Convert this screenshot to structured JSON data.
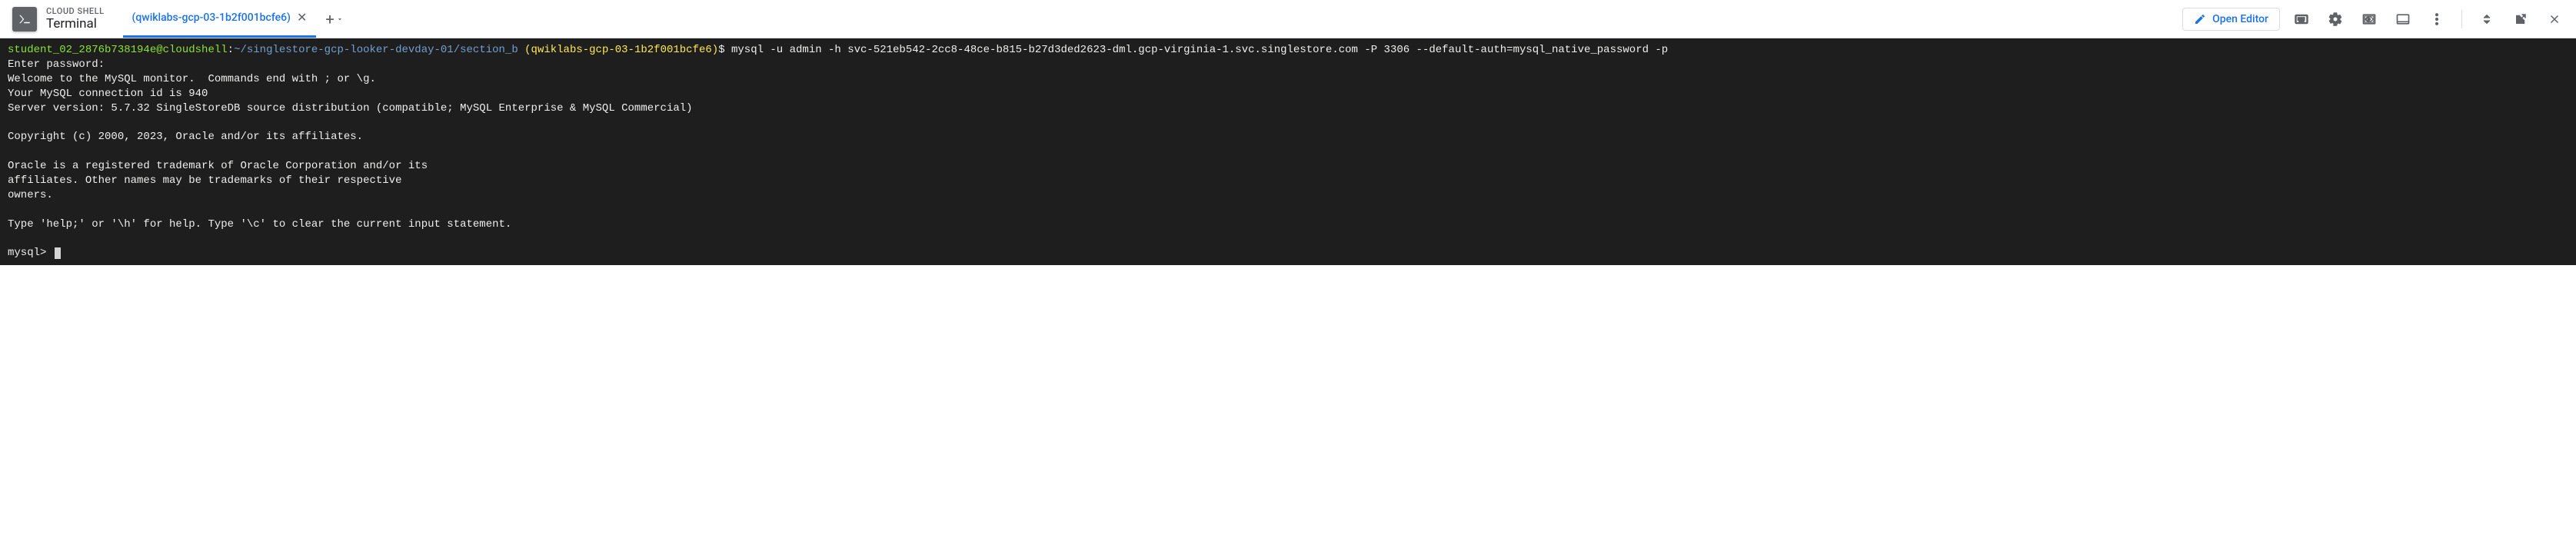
{
  "header": {
    "title_small": "CLOUD SHELL",
    "title_large": "Terminal",
    "tab_label": "(qwiklabs-gcp-03-1b2f001bcfe6)",
    "open_editor_label": "Open Editor"
  },
  "terminal": {
    "prompt_user": "student_02_2876b738194e@cloudshell",
    "prompt_colon": ":",
    "prompt_path": "~/singlestore-gcp-looker-devday-01/section_b",
    "prompt_project": " (qwiklabs-gcp-03-1b2f001bcfe6)",
    "prompt_dollar": "$ ",
    "command": "mysql -u admin -h svc-521eb542-2cc8-48ce-b815-b27d3ded2623-dml.gcp-virginia-1.svc.singlestore.com -P 3306 --default-auth=mysql_native_password -p",
    "output": "Enter password:\nWelcome to the MySQL monitor.  Commands end with ; or \\g.\nYour MySQL connection id is 940\nServer version: 5.7.32 SingleStoreDB source distribution (compatible; MySQL Enterprise & MySQL Commercial)\n\nCopyright (c) 2000, 2023, Oracle and/or its affiliates.\n\nOracle is a registered trademark of Oracle Corporation and/or its\naffiliates. Other names may be trademarks of their respective\nowners.\n\nType 'help;' or '\\h' for help. Type '\\c' to clear the current input statement.\n",
    "mysql_prompt": "mysql> "
  }
}
